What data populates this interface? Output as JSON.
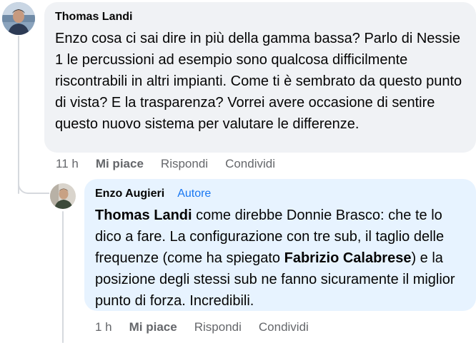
{
  "comment": {
    "author": "Thomas Landi",
    "text": "Enzo cosa ci sai dire in più della gamma bassa? Parlo di Nessie 1 le percussioni ad esempio sono qualcosa difficilmente riscontrabili in altri impianti. Come ti è sembrato da questo punto di vista? E la trasparenza? Vorrei avere occasione di sentire questo nuovo sistema per valutare le differenze.",
    "time": "11 h",
    "like_label": "Mi piace",
    "reply_label": "Rispondi",
    "share_label": "Condividi"
  },
  "reply": {
    "author": "Enzo Augieri",
    "badge": "Autore",
    "mention_1": "Thomas Landi",
    "text_1": " come direbbe Donnie Brasco: che te lo dico a fare. La configurazione con tre sub, il taglio delle frequenze (come ha spiegato ",
    "mention_2": "Fabrizio Calabrese",
    "text_2": ") e la posizione degli stessi sub ne fanno sicuramente il miglior punto di forza. Incredibili.",
    "time": "1 h",
    "like_label": "Mi piace",
    "reply_label": "Rispondi",
    "share_label": "Condividi"
  },
  "colors": {
    "comment_bubble": "#f0f2f5",
    "reply_bubble": "#e7f3ff",
    "author_badge": "#1877f2",
    "meta_text": "#65676b"
  }
}
